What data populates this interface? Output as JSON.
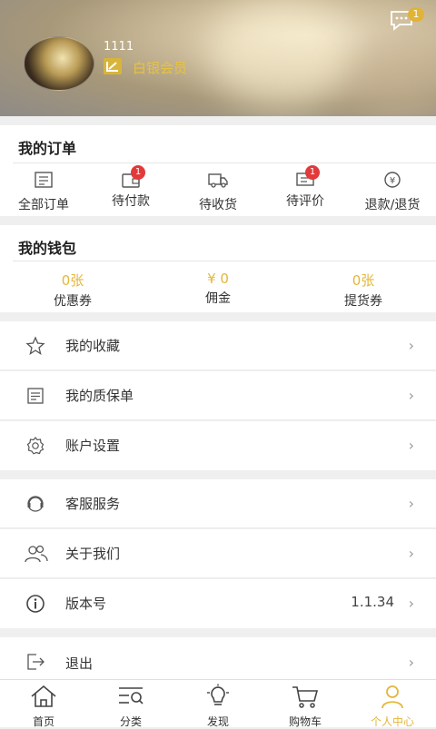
{
  "header": {
    "username": "1111",
    "level_text": "白银会员",
    "message_count": "1"
  },
  "orders": {
    "title": "我的订单",
    "items": [
      {
        "label": "全部订单",
        "icon": "all-orders-icon",
        "badge": ""
      },
      {
        "label": "待付款",
        "icon": "wallet-icon",
        "badge": "1"
      },
      {
        "label": "待收货",
        "icon": "truck-icon",
        "badge": ""
      },
      {
        "label": "待评价",
        "icon": "comment-icon",
        "badge": "1"
      },
      {
        "label": "退款/退货",
        "icon": "refund-icon",
        "badge": ""
      }
    ]
  },
  "wallet": {
    "title": "我的钱包",
    "items": [
      {
        "value": "0张",
        "label": "优惠券"
      },
      {
        "value": "¥ 0",
        "label": "佣金"
      },
      {
        "value": "0张",
        "label": "提货券"
      }
    ]
  },
  "menu": {
    "favorites": "我的收藏",
    "warranty": "我的质保单",
    "account": "账户设置",
    "service": "客服服务",
    "about": "关于我们",
    "version": "版本号",
    "version_value": "1.1.34",
    "logout": "退出"
  },
  "tabs": [
    {
      "label": "首页",
      "icon": "home-icon"
    },
    {
      "label": "分类",
      "icon": "category-icon"
    },
    {
      "label": "发现",
      "icon": "bulb-icon"
    },
    {
      "label": "购物车",
      "icon": "cart-icon"
    },
    {
      "label": "个人中心",
      "icon": "user-icon"
    }
  ],
  "colors": {
    "accent": "#e4b63a",
    "badge": "#e23a3a"
  }
}
